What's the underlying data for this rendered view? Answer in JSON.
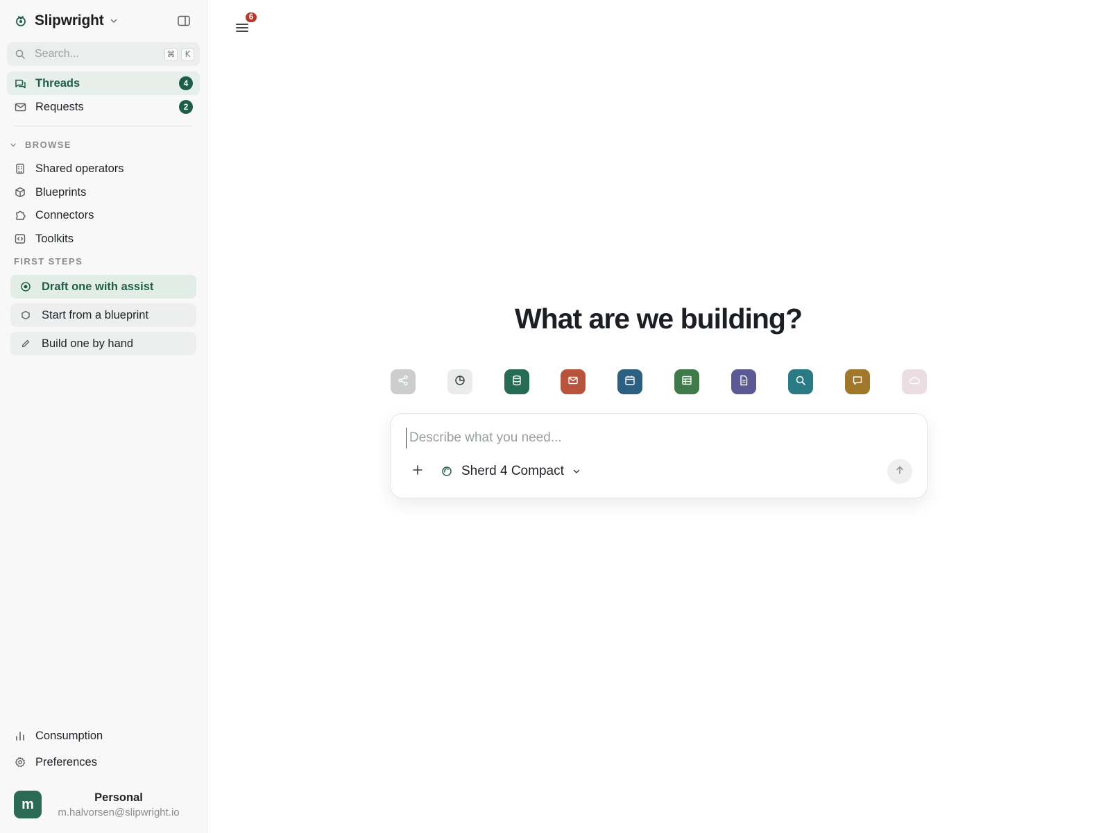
{
  "workspace": {
    "name": "Slipwright"
  },
  "search": {
    "placeholder": "Search...",
    "shortcut_mod": "⌘",
    "shortcut_key": "K"
  },
  "nav": [
    {
      "label": "Threads",
      "badge": "4",
      "icon": "chat-bubbles-icon",
      "active": true
    },
    {
      "label": "Requests",
      "badge": "2",
      "icon": "mail-icon",
      "active": false
    }
  ],
  "browse": {
    "title": "BROWSE",
    "items": [
      {
        "label": "Shared operators",
        "icon": "building-icon"
      },
      {
        "label": "Blueprints",
        "icon": "cube-icon"
      },
      {
        "label": "Connectors",
        "icon": "puzzle-icon"
      },
      {
        "label": "Toolkits",
        "icon": "code-box-icon"
      }
    ]
  },
  "first_steps": {
    "title": "FIRST STEPS",
    "items": [
      {
        "label": "Draft one with assist",
        "icon": "target-icon",
        "active": true
      },
      {
        "label": "Start from a blueprint",
        "icon": "hexagon-icon",
        "active": false
      },
      {
        "label": "Build one by hand",
        "icon": "pencil-icon",
        "active": false
      }
    ]
  },
  "footer": {
    "items": [
      {
        "label": "Consumption",
        "icon": "bar-chart-icon"
      },
      {
        "label": "Preferences",
        "icon": "gear-icon"
      }
    ],
    "account": {
      "avatar_letter": "m",
      "name": "Personal",
      "email": "m.halvorsen@slipwright.io"
    }
  },
  "topbar": {
    "notification_count": "6"
  },
  "main": {
    "headline": "What are we building?",
    "connectors": [
      {
        "icon": "share-icon",
        "color": "#8d9390"
      },
      {
        "icon": "pie-chart-icon",
        "color": "#e9ecea"
      },
      {
        "icon": "database-icon",
        "color": "#276b55"
      },
      {
        "icon": "mail-icon",
        "color": "#b8533e"
      },
      {
        "icon": "calendar-icon",
        "color": "#2c5f80"
      },
      {
        "icon": "table-icon",
        "color": "#3f7a4a"
      },
      {
        "icon": "document-icon",
        "color": "#5b5a95"
      },
      {
        "icon": "search-icon",
        "color": "#2a7a85"
      },
      {
        "icon": "chat-icon",
        "color": "#a0782c"
      },
      {
        "icon": "cloud-icon",
        "color": "#c9a0ad"
      }
    ],
    "composer": {
      "placeholder": "Describe what you need...",
      "value": "",
      "model": "Sherd 4 Compact"
    }
  },
  "colors": {
    "accent": "#1e5e48",
    "badge_alert": "#b5382d",
    "sidebar_bg": "#f7f8f7"
  }
}
